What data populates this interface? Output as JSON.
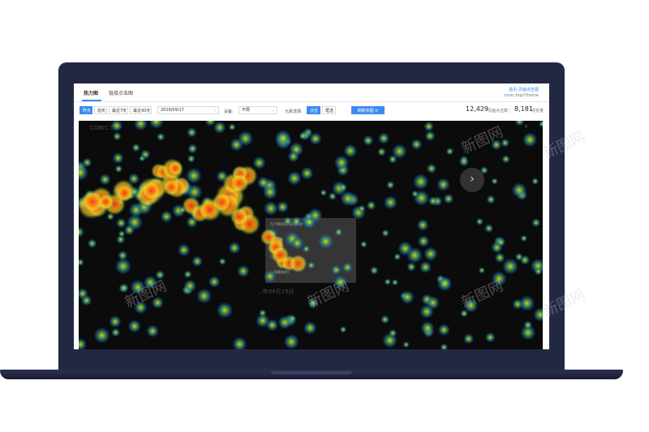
{
  "tabs": [
    {
      "label": "热力图",
      "active": true
    },
    {
      "label": "链接点击图",
      "active": false
    }
  ],
  "header": {
    "breadcrumb": "首页-页面点击图",
    "subtitle": "conic.top/?/home"
  },
  "filters": {
    "quick_ranges": [
      "昨天",
      "前天",
      "最近7天",
      "最近30天"
    ],
    "active_range": "昨天",
    "date_value": "2019/09/17",
    "device_label": "设备:",
    "device_value": "不限",
    "element_label": "元素选择:",
    "element_options": [
      "点击",
      "框选"
    ],
    "element_active": "点击",
    "refresh_label": "刷新热图"
  },
  "stats": [
    {
      "value": "12,429",
      "label": "页面点击数"
    },
    {
      "value": "8,181",
      "label": "浏览量"
    }
  ],
  "heatmap": {
    "site_logo_text": "CONIC.TOP",
    "popup_lines": [
      "为了降低您的观看体验",
      "...的设置",
      "(注意...)",
      "...(观看体验)"
    ],
    "headline_text": "...年09月19日",
    "colors": {
      "hot": "#e53935",
      "warm": "#fdd835",
      "cool": "#43a047",
      "cold": "#1565c0"
    }
  },
  "watermarks": [
    "新图网",
    "新图网",
    "新图网",
    "新图网",
    "新图网",
    "新图网"
  ],
  "icons": {
    "refresh": "refresh-icon",
    "chevron": "chevron-down-icon",
    "arrow": "arrow-right-icon",
    "close": "close-icon"
  }
}
